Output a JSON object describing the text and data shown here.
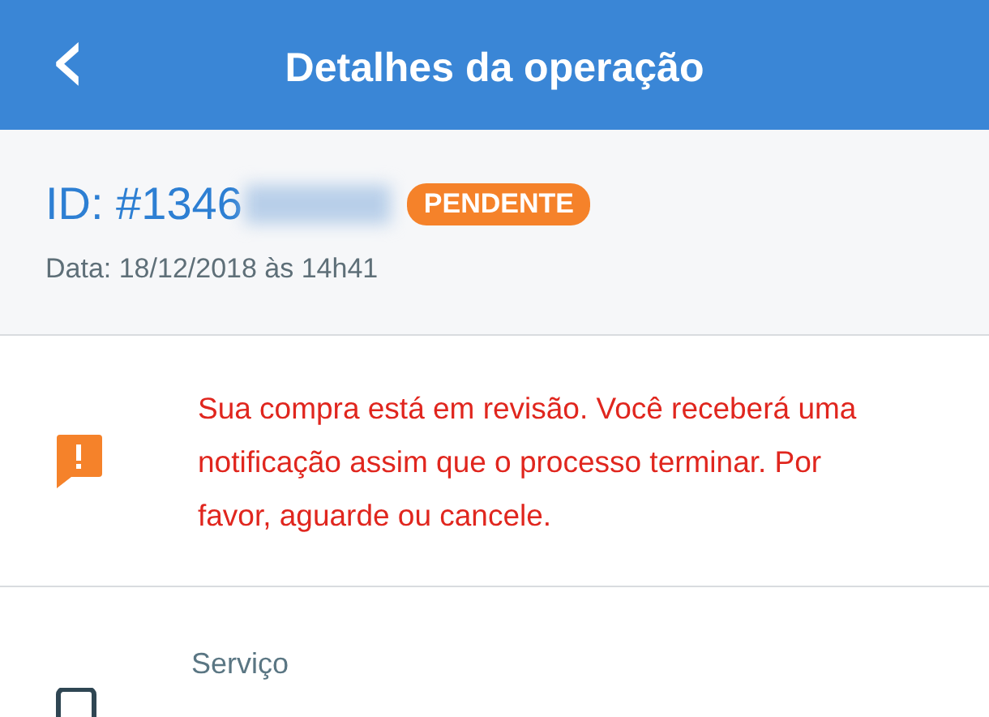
{
  "header": {
    "back": "‹",
    "title": "Detalhes da operação"
  },
  "operation": {
    "id": "ID: #1346",
    "id_redacted": true,
    "status": {
      "label": "PENDENTE",
      "color": "#f5822a"
    },
    "date": "Data: 18/12/2018 às 14h41"
  },
  "notice": {
    "message": "Sua compra está em revisão. Você receberá uma notificação assim que o processo terminar. Por favor, aguarde ou cancele."
  },
  "service": {
    "label": "Serviço"
  }
}
